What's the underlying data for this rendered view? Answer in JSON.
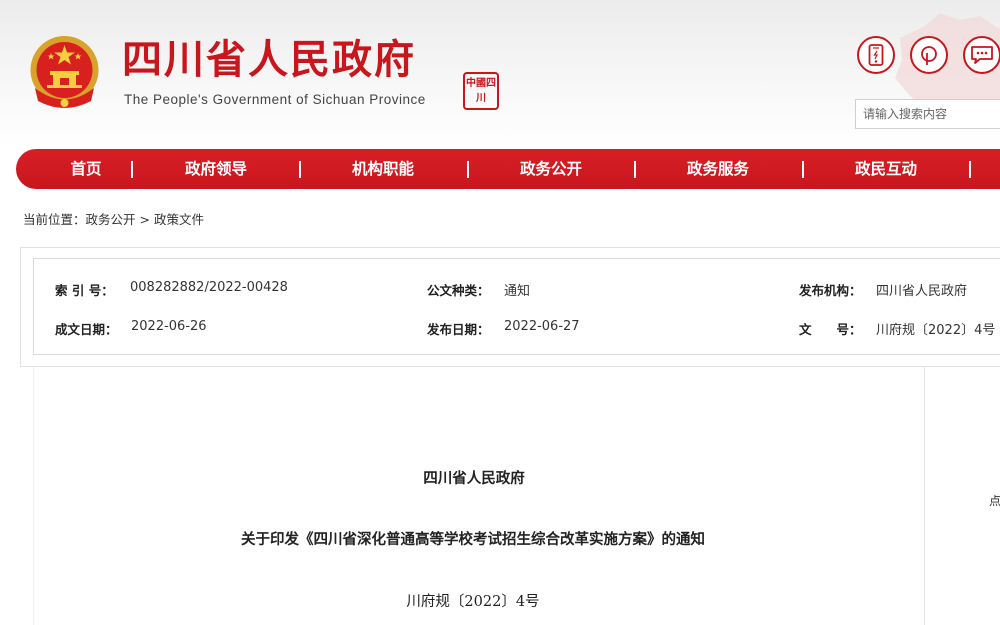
{
  "header": {
    "site_title": "四川省人民政府",
    "site_subtitle": "The People's Government of Sichuan Province",
    "seal_text": "中國四川",
    "icons": [
      "mobile-icon",
      "weibo-icon",
      "message-icon"
    ],
    "search_placeholder": "请输入搜索内容"
  },
  "nav": {
    "items": [
      {
        "label": "首页"
      },
      {
        "label": "政府领导"
      },
      {
        "label": "机构职能"
      },
      {
        "label": "政务公开"
      },
      {
        "label": "政务服务"
      },
      {
        "label": "政民互动"
      }
    ]
  },
  "breadcrumb": {
    "prefix": "当前位置：",
    "items": [
      "政务公开",
      "政策文件"
    ],
    "separator": ">"
  },
  "info": {
    "index_label": "索 引 号：",
    "index_value": "008282882/2022-00428",
    "doc_type_label": "公文种类：",
    "doc_type_value": "通知",
    "publisher_label": "发布机构：",
    "publisher_value": "四川省人民政府",
    "created_label": "成文日期：",
    "created_value": "2022-06-26",
    "published_label": "发布日期：",
    "published_value": "2022-06-27",
    "docno_label": "文　　号：",
    "docno_value": "川府规〔2022〕4号"
  },
  "document": {
    "issuer": "四川省人民政府",
    "title": "关于印发《四川省深化普通高等学校考试招生综合改革实施方案》的通知",
    "number": "川府规〔2022〕4号"
  },
  "side": {
    "partial_char": "点"
  },
  "colors": {
    "brand_red": "#c8161d",
    "nav_red": "#d81f26"
  }
}
